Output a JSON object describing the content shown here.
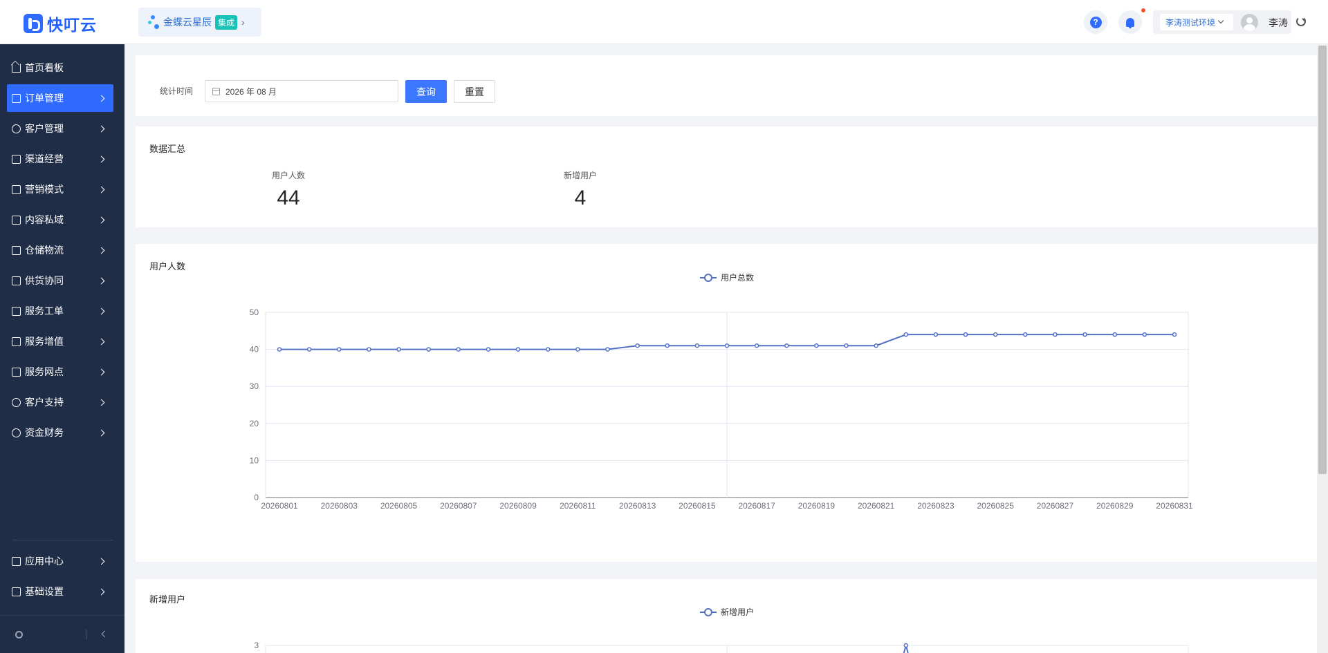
{
  "header": {
    "logo_text": "快叮云",
    "product": {
      "name": "金蝶云星辰",
      "tag": "集成"
    },
    "environment": "李涛测试环境",
    "user_name": "李涛",
    "help_glyph": "?"
  },
  "sidebar": {
    "items": [
      {
        "label": "首页看板",
        "icon": "home-icon",
        "has_children": false
      },
      {
        "label": "订单管理",
        "icon": "clipboard-icon",
        "has_children": true,
        "active": true
      },
      {
        "label": "客户管理",
        "icon": "user-icon",
        "has_children": true
      },
      {
        "label": "渠道经营",
        "icon": "channel-icon",
        "has_children": true
      },
      {
        "label": "营销模式",
        "icon": "tag-icon",
        "has_children": true
      },
      {
        "label": "内容私域",
        "icon": "image-icon",
        "has_children": true
      },
      {
        "label": "仓储物流",
        "icon": "box-icon",
        "has_children": true
      },
      {
        "label": "供货协同",
        "icon": "supplier-icon",
        "has_children": true
      },
      {
        "label": "服务工单",
        "icon": "ticket-icon",
        "has_children": true
      },
      {
        "label": "服务增值",
        "icon": "bag-icon",
        "has_children": true
      },
      {
        "label": "服务网点",
        "icon": "store-icon",
        "has_children": true
      },
      {
        "label": "客户支持",
        "icon": "support-icon",
        "has_children": true
      },
      {
        "label": "资金财务",
        "icon": "yuan-icon",
        "has_children": true
      }
    ],
    "bottom_items": [
      {
        "label": "应用中心",
        "icon": "cube-icon",
        "has_children": true
      },
      {
        "label": "基础设置",
        "icon": "sliders-icon",
        "has_children": true
      }
    ]
  },
  "filter": {
    "label": "统计时间",
    "date_value": "2026 年 08 月",
    "query_button": "查询",
    "reset_button": "重置"
  },
  "summary": {
    "title": "数据汇总",
    "stats": [
      {
        "label": "用户人数",
        "value": "44"
      },
      {
        "label": "新增用户",
        "value": "4"
      }
    ]
  },
  "colors": {
    "accent": "#2f6bff",
    "sidebar_bg": "#1f2d47",
    "series": "#5470c6"
  },
  "chart_data": [
    {
      "type": "line",
      "title": "用户人数",
      "legend": [
        "用户总数"
      ],
      "legend_position": "top-center",
      "x": [
        "20260801",
        "20260802",
        "20260803",
        "20260804",
        "20260805",
        "20260806",
        "20260807",
        "20260808",
        "20260809",
        "20260810",
        "20260811",
        "20260812",
        "20260813",
        "20260814",
        "20260815",
        "20260816",
        "20260817",
        "20260818",
        "20260819",
        "20260820",
        "20260821",
        "20260822",
        "20260823",
        "20260824",
        "20260825",
        "20260826",
        "20260827",
        "20260828",
        "20260829",
        "20260830",
        "20260831"
      ],
      "x_tick_labels": [
        "20260801",
        "20260803",
        "20260805",
        "20260807",
        "20260809",
        "20260811",
        "20260813",
        "20260815",
        "20260817",
        "20260819",
        "20260821",
        "20260823",
        "20260825",
        "20260827",
        "20260829",
        "20260831"
      ],
      "series": [
        {
          "name": "用户总数",
          "values": [
            40,
            40,
            40,
            40,
            40,
            40,
            40,
            40,
            40,
            40,
            40,
            40,
            41,
            41,
            41,
            41,
            41,
            41,
            41,
            41,
            41,
            44,
            44,
            44,
            44,
            44,
            44,
            44,
            44,
            44,
            44
          ]
        }
      ],
      "ylim": [
        0,
        50
      ],
      "y_ticks": [
        0,
        10,
        20,
        30,
        40,
        50
      ],
      "grid": true
    },
    {
      "type": "line",
      "title": "新增用户",
      "legend": [
        "新增用户"
      ],
      "legend_position": "top-center",
      "visible_y_ticks": [
        3
      ],
      "ylim_max": 3,
      "series": [
        {
          "name": "新增用户",
          "peak_value": 3,
          "peak_x": "20260822"
        }
      ]
    }
  ]
}
